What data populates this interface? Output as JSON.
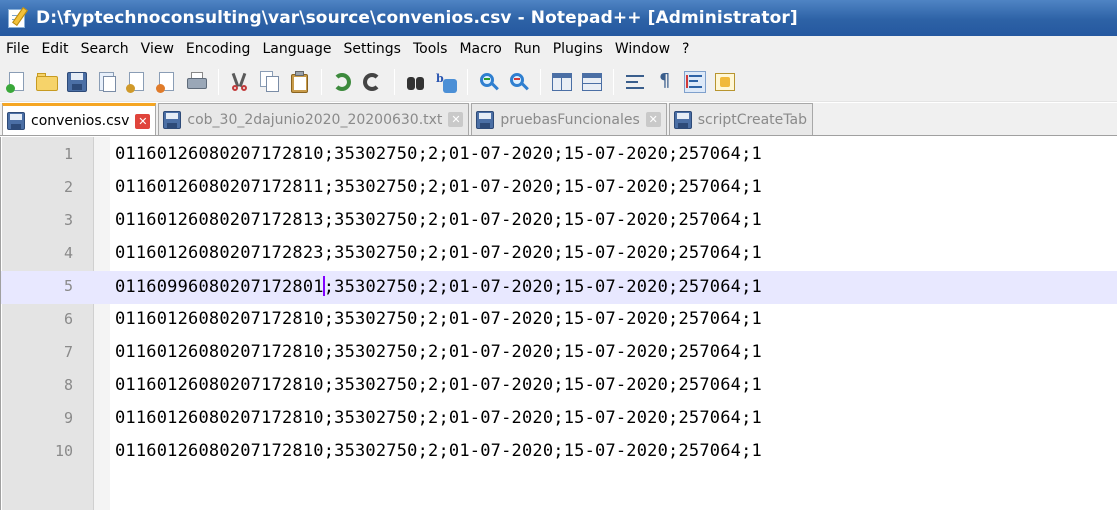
{
  "window": {
    "title": "D:\\fyptechnoconsulting\\var\\source\\convenios.csv - Notepad++ [Administrator]"
  },
  "menu": {
    "items": [
      "File",
      "Edit",
      "Search",
      "View",
      "Encoding",
      "Language",
      "Settings",
      "Tools",
      "Macro",
      "Run",
      "Plugins",
      "Window",
      "?"
    ]
  },
  "toolbar": {
    "buttons": [
      "new-file",
      "open-file",
      "save",
      "save-all",
      "close",
      "close-all",
      "print",
      "cut",
      "copy",
      "paste",
      "undo",
      "redo",
      "find",
      "replace",
      "zoom-in",
      "zoom-out",
      "sync-vertical",
      "sync-horizontal",
      "word-wrap",
      "show-all-characters",
      "indent-guide",
      "document-map"
    ]
  },
  "tabs": [
    {
      "label": "convenios.csv",
      "active": true
    },
    {
      "label": "cob_30_2dajunio2020_20200630.txt",
      "active": false
    },
    {
      "label": "pruebasFuncionales",
      "active": false
    },
    {
      "label": "scriptCreateTab",
      "active": false
    }
  ],
  "editor": {
    "current_line": 5,
    "caret_after": "01160996080207172801",
    "lines": [
      {
        "number": "1",
        "text": "01160126080207172810;35302750;2;01-07-2020;15-07-2020;257064;1"
      },
      {
        "number": "2",
        "text": "01160126080207172811;35302750;2;01-07-2020;15-07-2020;257064;1"
      },
      {
        "number": "3",
        "text": "01160126080207172813;35302750;2;01-07-2020;15-07-2020;257064;1"
      },
      {
        "number": "4",
        "text": "01160126080207172823;35302750;2;01-07-2020;15-07-2020;257064;1"
      },
      {
        "number": "5",
        "text_before_caret": "01160996080207172801",
        "text_after_caret": ";35302750;2;01-07-2020;15-07-2020;257064;1"
      },
      {
        "number": "6",
        "text": "01160126080207172810;35302750;2;01-07-2020;15-07-2020;257064;1"
      },
      {
        "number": "7",
        "text": "01160126080207172810;35302750;2;01-07-2020;15-07-2020;257064;1"
      },
      {
        "number": "8",
        "text": "01160126080207172810;35302750;2;01-07-2020;15-07-2020;257064;1"
      },
      {
        "number": "9",
        "text": "01160126080207172810;35302750;2;01-07-2020;15-07-2020;257064;1"
      },
      {
        "number": "10",
        "text": "01160126080207172810;35302750;2;01-07-2020;15-07-2020;257064;1"
      }
    ]
  },
  "colors": {
    "title_bar": "#2d62a6",
    "active_tab_accent": "#f5a623",
    "current_line_highlight": "#e8e8ff",
    "caret": "#8000ff"
  }
}
